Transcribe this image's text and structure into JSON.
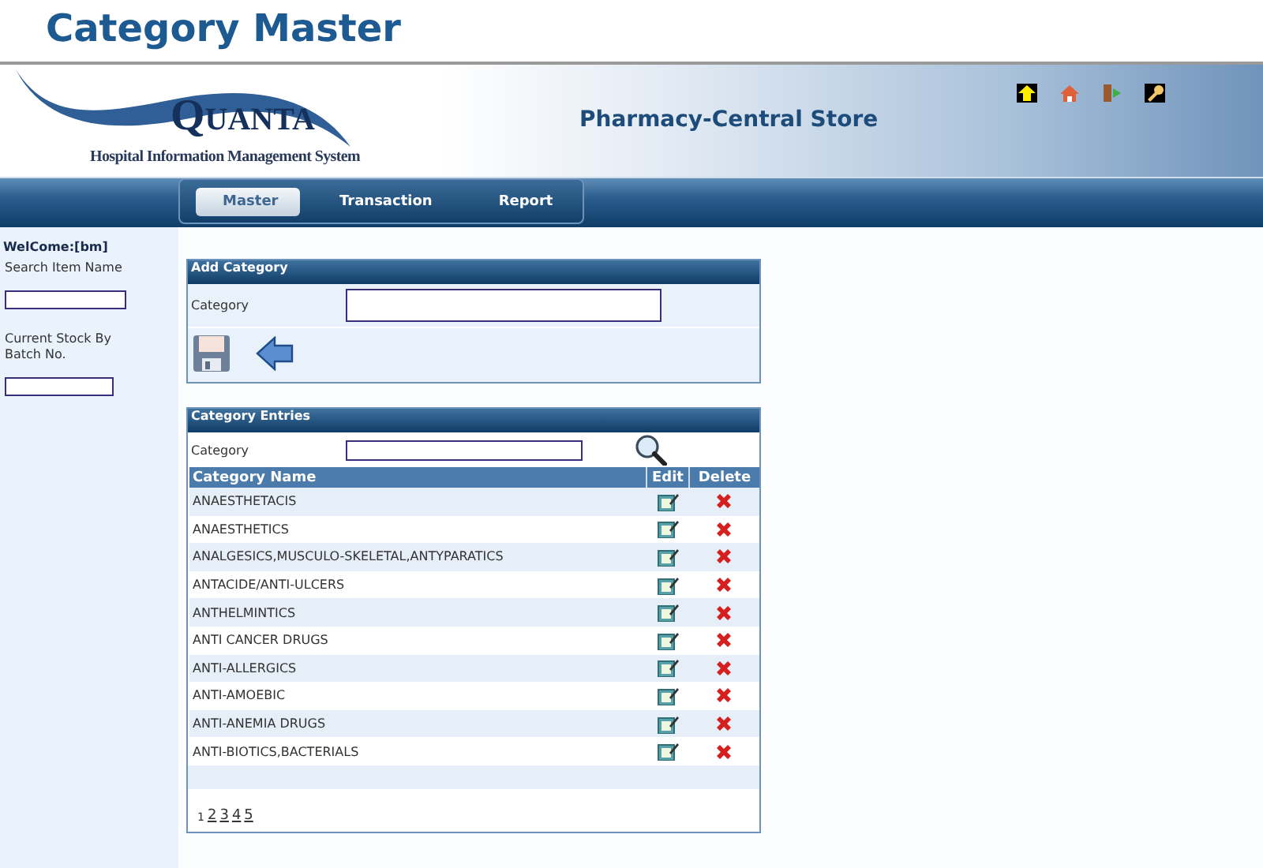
{
  "page_title": "Category Master",
  "header": {
    "logo": {
      "name": "QUANTA",
      "subtitle": "Hospital Information Management System"
    },
    "store_name": "Pharmacy-Central Store"
  },
  "nav_tabs": [
    {
      "label": "Master",
      "selected": true
    },
    {
      "label": "Transaction",
      "selected": false
    },
    {
      "label": "Report",
      "selected": false
    }
  ],
  "sidebar": {
    "welcome": "WelCome:[bm]",
    "fields": [
      {
        "label": "Search Item Name"
      },
      {
        "label": "Current Stock By Batch No."
      }
    ]
  },
  "add_category": {
    "title": "Add Category",
    "field_label": "Category"
  },
  "category_entries": {
    "title": "Category Entries",
    "search_label": "Category",
    "columns": [
      "Category Name",
      "Edit",
      "Delete"
    ],
    "rows": [
      "ANAESTHETACIS",
      "ANAESTHETICS",
      "ANALGESICS,MUSCULO-SKELETAL,ANTYPARATICS",
      "ANTACIDE/ANTI-ULCERS",
      "ANTHELMINTICS",
      "ANTI CANCER DRUGS",
      "ANTI-ALLERGICS",
      "ANTI-AMOEBIC",
      "ANTI-ANEMIA DRUGS",
      "ANTI-BIOTICS,BACTERIALS"
    ],
    "pages": [
      {
        "label": "1",
        "selected": true
      },
      {
        "label": "2",
        "selected": false
      },
      {
        "label": "3",
        "selected": false
      },
      {
        "label": "4",
        "selected": false
      },
      {
        "label": "5",
        "selected": false
      }
    ]
  }
}
